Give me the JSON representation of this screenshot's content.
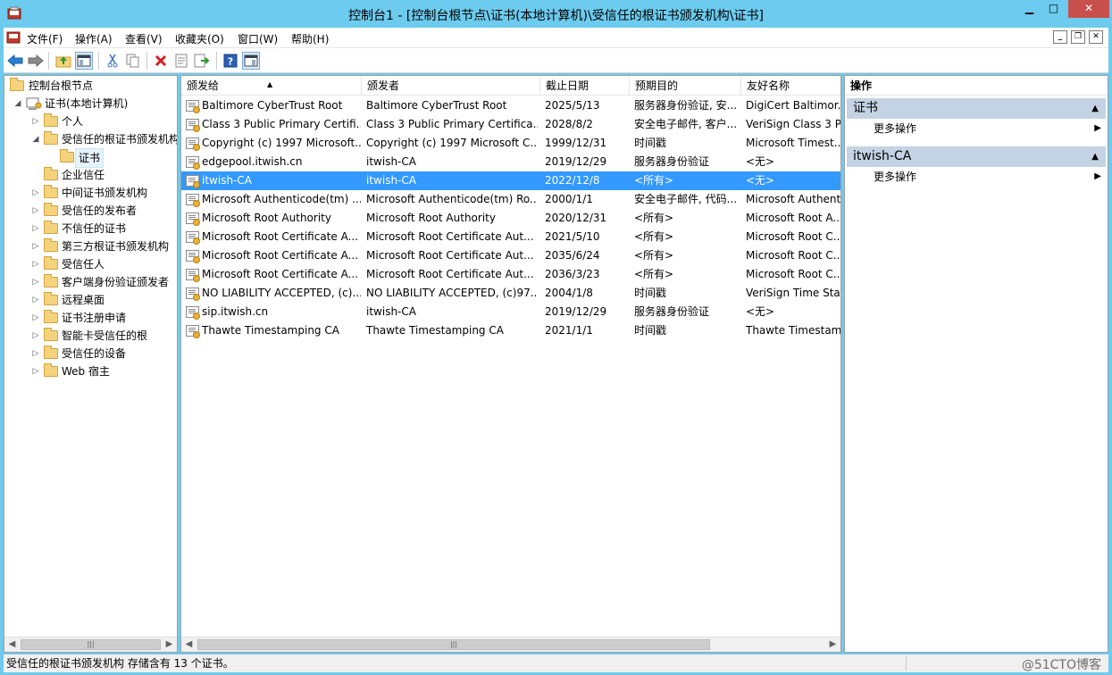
{
  "window": {
    "title": "控制台1 - [控制台根节点\\证书(本地计算机)\\受信任的根证书颁发机构\\证书]",
    "min_label": "▁",
    "max_label": "□",
    "close_label": "✕"
  },
  "menu": {
    "items": [
      "文件(F)",
      "操作(A)",
      "查看(V)",
      "收藏夹(O)",
      "窗口(W)",
      "帮助(H)"
    ],
    "mdi_min": "_",
    "mdi_restore": "❐",
    "mdi_close": "✕"
  },
  "toolbar": {
    "icons": [
      "back-icon",
      "forward-icon",
      "up-folder-icon",
      "show-tree-icon",
      "cut-icon",
      "copy-icon",
      "delete-icon",
      "properties-icon",
      "export-icon",
      "help-icon",
      "show-action-pane-icon"
    ]
  },
  "tree": {
    "root": "控制台根节点",
    "computer": "证书(本地计算机)",
    "items": [
      {
        "label": "个人",
        "expandable": true
      },
      {
        "label": "受信任的根证书颁发机构",
        "expandable": true,
        "expanded": true
      },
      {
        "label": "证书",
        "expandable": false,
        "selected": true
      },
      {
        "label": "企业信任",
        "expandable": false
      },
      {
        "label": "中间证书颁发机构",
        "expandable": true
      },
      {
        "label": "受信任的发布者",
        "expandable": true
      },
      {
        "label": "不信任的证书",
        "expandable": true
      },
      {
        "label": "第三方根证书颁发机构",
        "expandable": true
      },
      {
        "label": "受信任人",
        "expandable": true
      },
      {
        "label": "客户端身份验证颁发者",
        "expandable": true
      },
      {
        "label": "远程桌面",
        "expandable": true
      },
      {
        "label": "证书注册申请",
        "expandable": true
      },
      {
        "label": "智能卡受信任的根",
        "expandable": true
      },
      {
        "label": "受信任的设备",
        "expandable": true
      },
      {
        "label": "Web 宿主",
        "expandable": true
      }
    ]
  },
  "list": {
    "columns": [
      "颁发给",
      "颁发者",
      "截止日期",
      "预期目的",
      "友好名称"
    ],
    "sort_indicator": "▲",
    "rows": [
      {
        "issued_to": "Baltimore CyberTrust Root",
        "issued_by": "Baltimore CyberTrust Root",
        "expires": "2025/5/13",
        "purpose": "服务器身份验证, 安...",
        "friendly": "DigiCert Baltimor..."
      },
      {
        "issued_to": "Class 3 Public Primary Certifi...",
        "issued_by": "Class 3 Public Primary Certifica...",
        "expires": "2028/8/2",
        "purpose": "安全电子邮件, 客户...",
        "friendly": "VeriSign Class 3 P..."
      },
      {
        "issued_to": "Copyright (c) 1997 Microsoft...",
        "issued_by": "Copyright (c) 1997 Microsoft C...",
        "expires": "1999/12/31",
        "purpose": "时间戳",
        "friendly": "Microsoft Timest..."
      },
      {
        "issued_to": "edgepool.itwish.cn",
        "issued_by": "itwish-CA",
        "expires": "2019/12/29",
        "purpose": "服务器身份验证",
        "friendly": "<无>"
      },
      {
        "issued_to": "itwish-CA",
        "issued_by": "itwish-CA",
        "expires": "2022/12/8",
        "purpose": "<所有>",
        "friendly": "<无>",
        "selected": true
      },
      {
        "issued_to": "Microsoft Authenticode(tm) ...",
        "issued_by": "Microsoft Authenticode(tm) Ro...",
        "expires": "2000/1/1",
        "purpose": "安全电子邮件, 代码...",
        "friendly": "Microsoft Authent..."
      },
      {
        "issued_to": "Microsoft Root Authority",
        "issued_by": "Microsoft Root Authority",
        "expires": "2020/12/31",
        "purpose": "<所有>",
        "friendly": "Microsoft Root A..."
      },
      {
        "issued_to": "Microsoft Root Certificate A...",
        "issued_by": "Microsoft Root Certificate Aut...",
        "expires": "2021/5/10",
        "purpose": "<所有>",
        "friendly": "Microsoft Root C..."
      },
      {
        "issued_to": "Microsoft Root Certificate A...",
        "issued_by": "Microsoft Root Certificate Aut...",
        "expires": "2035/6/24",
        "purpose": "<所有>",
        "friendly": "Microsoft Root C..."
      },
      {
        "issued_to": "Microsoft Root Certificate A...",
        "issued_by": "Microsoft Root Certificate Aut...",
        "expires": "2036/3/23",
        "purpose": "<所有>",
        "friendly": "Microsoft Root C..."
      },
      {
        "issued_to": "NO LIABILITY ACCEPTED, (c)...",
        "issued_by": "NO LIABILITY ACCEPTED, (c)97...",
        "expires": "2004/1/8",
        "purpose": "时间戳",
        "friendly": "VeriSign Time Sta..."
      },
      {
        "issued_to": "sip.itwish.cn",
        "issued_by": "itwish-CA",
        "expires": "2019/12/29",
        "purpose": "服务器身份验证",
        "friendly": "<无>"
      },
      {
        "issued_to": "Thawte Timestamping CA",
        "issued_by": "Thawte Timestamping CA",
        "expires": "2021/1/1",
        "purpose": "时间戳",
        "friendly": "Thawte Timestam..."
      }
    ]
  },
  "actions": {
    "header": "操作",
    "sections": [
      {
        "title": "证书",
        "items": [
          "更多操作"
        ]
      },
      {
        "title": "itwish-CA",
        "items": [
          "更多操作"
        ]
      }
    ]
  },
  "scroll": {
    "left": "◀",
    "right": "▶",
    "grip": "|||"
  },
  "status": {
    "text": "受信任的根证书颁发机构 存储含有 13 个证书。",
    "watermark": "@51CTO博客"
  },
  "colors": {
    "titlebar": "#6ccbee",
    "selection": "#3399ff",
    "action_section": "#c3d3e4",
    "close_button": "#c7504c"
  }
}
